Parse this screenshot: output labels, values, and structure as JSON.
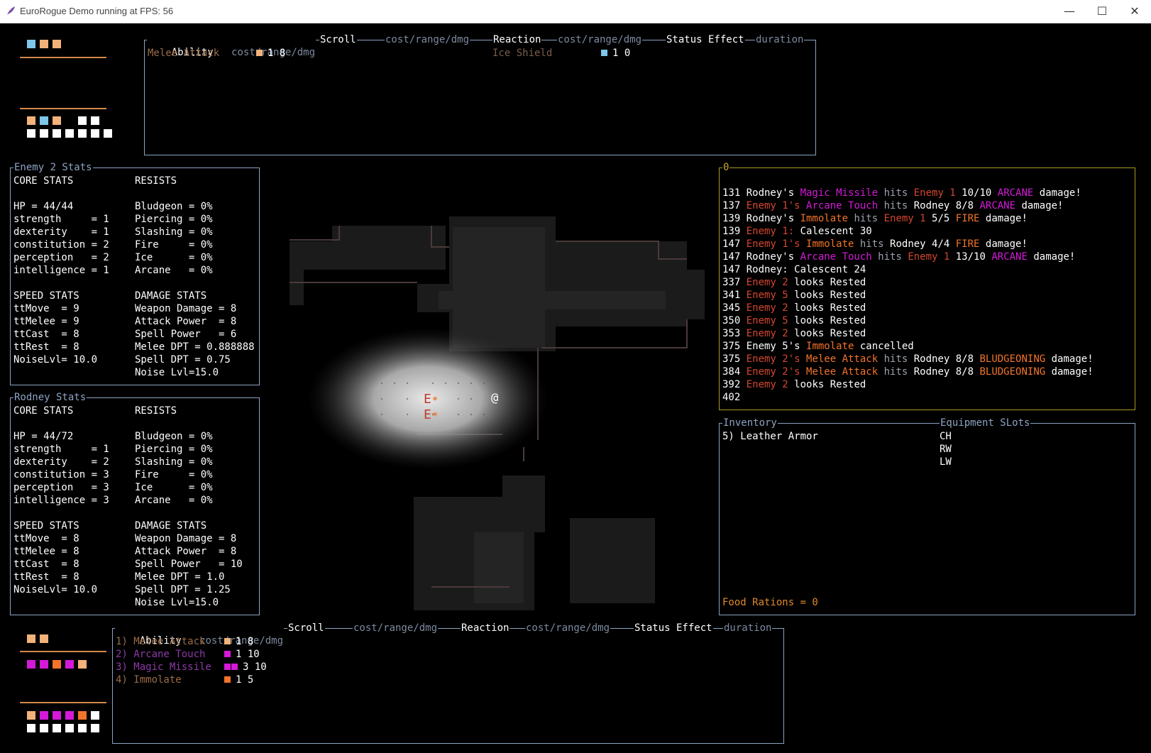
{
  "window": {
    "title": "EuroRogue Demo running at FPS: 56",
    "minimize": "—",
    "maximize": "☐",
    "close": "✕",
    "icon": "feather-icon"
  },
  "colors": {
    "panel_border": "#8da3c2",
    "log_border": "#a89a23",
    "resource_orange": "#f2b27a",
    "resource_blue": "#7ec7ea",
    "resource_magenta": "#d41ad8",
    "resource_fire": "#f2742a"
  },
  "top_ability_bar": {
    "headers": {
      "ability": "Ability",
      "ability_cost": "cost/range/dmg",
      "scroll": "Scroll",
      "scroll_cost": "cost/range/dmg",
      "reaction": "Reaction",
      "reaction_cost": "cost/range/dmg",
      "status": "Status Effect",
      "status_duration": "duration"
    },
    "abilities": [
      {
        "name": "Melee Attack",
        "cost": "1 8",
        "pip_colors": [
          "#f2b27a"
        ]
      }
    ],
    "reactions": [
      {
        "name": "Ice Shield",
        "cost": "1 0",
        "pip_colors": [
          "#7ec7ea"
        ]
      }
    ],
    "resource_row1": [
      "#7ec7ea",
      "#f2b27a",
      "#f2b27a"
    ],
    "resource_row2": [
      "#f2b27a",
      "#7ec7ea",
      "#f2b27a",
      "",
      "#ffffff",
      "#ffffff"
    ],
    "resource_row3": [
      "#ffffff",
      "#ffffff",
      "#ffffff",
      "#ffffff",
      "#ffffff",
      "#ffffff",
      "#ffffff"
    ]
  },
  "enemy_stats": {
    "title": "Enemy 2 Stats",
    "core_header": "CORE STATS",
    "resists_header": "RESISTS",
    "speed_header": "SPEED STATS",
    "damage_header": "DAMAGE STATS",
    "core": [
      "HP = 44/44",
      "strength     = 1",
      "dexterity    = 1",
      "constitution = 2",
      "perception   = 2",
      "intelligence = 1"
    ],
    "resists": [
      "Bludgeon = 0%",
      "Piercing = 0%",
      "Slashing = 0%",
      "Fire     = 0%",
      "Ice      = 0%",
      "Arcane   = 0%"
    ],
    "speed": [
      "ttMove  = 9",
      "ttMelee = 9",
      "ttCast  = 8",
      "ttRest  = 8",
      "",
      "NoiseLvl= 10.0"
    ],
    "damage": [
      "Weapon Damage = 8",
      "Attack Power  = 8",
      "Spell Power   = 6",
      "Melee DPT = 0.888888",
      "Spell DPT = 0.75",
      "Noise Lvl=15.0"
    ]
  },
  "player_stats": {
    "title": "Rodney Stats",
    "core_header": "CORE STATS",
    "resists_header": "RESISTS",
    "speed_header": "SPEED STATS",
    "damage_header": "DAMAGE STATS",
    "core": [
      "HP = 44/72",
      "strength     = 1",
      "dexterity    = 2",
      "constitution = 3",
      "perception   = 3",
      "intelligence = 3"
    ],
    "resists": [
      "Bludgeon = 0%",
      "Piercing = 0%",
      "Slashing = 0%",
      "Fire     = 0%",
      "Ice      = 0%",
      "Arcane   = 0%"
    ],
    "speed": [
      "ttMove  = 8",
      "ttMelee = 8",
      "ttCast  = 8",
      "ttRest  = 8",
      "",
      "NoiseLvl= 10.0"
    ],
    "damage": [
      "Weapon Damage = 8",
      "Attack Power  = 8",
      "Spell Power   = 10",
      "Melee DPT = 1.0",
      "Spell DPT = 1.25",
      "Noise Lvl=15.0"
    ]
  },
  "map": {
    "player_glyph": "@",
    "enemy_glyphs": [
      "E",
      "E"
    ]
  },
  "log": {
    "title": "0",
    "lines": [
      [
        [
          "131 Rodney's ",
          "white"
        ],
        [
          "Magic Missile",
          "mag"
        ],
        [
          " hits ",
          "gray"
        ],
        [
          "Enemy 1",
          "red"
        ],
        [
          " 10/10 ",
          "white"
        ],
        [
          "ARCANE",
          "mag"
        ],
        [
          " damage!",
          "white"
        ]
      ],
      [
        [
          "137 ",
          "white"
        ],
        [
          "Enemy 1's ",
          "red"
        ],
        [
          "Arcane Touch",
          "mag"
        ],
        [
          " hits ",
          "gray"
        ],
        [
          "Rodney 8/8 ",
          "white"
        ],
        [
          "ARCANE",
          "mag"
        ],
        [
          " damage!",
          "white"
        ]
      ],
      [
        [
          "139 Rodney's ",
          "white"
        ],
        [
          "Immolate",
          "orange"
        ],
        [
          " hits ",
          "gray"
        ],
        [
          "Enemy 1",
          "red"
        ],
        [
          " 5/5 ",
          "white"
        ],
        [
          "FIRE",
          "orange"
        ],
        [
          " damage!",
          "white"
        ]
      ],
      [
        [
          "139 ",
          "white"
        ],
        [
          "Enemy 1:",
          "red"
        ],
        [
          " Calescent 30",
          "white"
        ]
      ],
      [
        [
          "147 ",
          "white"
        ],
        [
          "Enemy 1's ",
          "red"
        ],
        [
          "Immolate",
          "orange"
        ],
        [
          " hits ",
          "gray"
        ],
        [
          "Rodney 4/4 ",
          "white"
        ],
        [
          "FIRE",
          "orange"
        ],
        [
          " damage!",
          "white"
        ]
      ],
      [
        [
          "147 Rodney's ",
          "white"
        ],
        [
          "Arcane Touch",
          "mag"
        ],
        [
          " hits ",
          "gray"
        ],
        [
          "Enemy 1",
          "red"
        ],
        [
          " 13/10 ",
          "white"
        ],
        [
          "ARCANE",
          "mag"
        ],
        [
          " damage!",
          "white"
        ]
      ],
      [
        [
          "147 Rodney: Calescent 24",
          "white"
        ]
      ],
      [
        [
          "337 ",
          "white"
        ],
        [
          "Enemy 2",
          "red"
        ],
        [
          " looks Rested",
          "white"
        ]
      ],
      [
        [
          "341 ",
          "white"
        ],
        [
          "Enemy 5",
          "red"
        ],
        [
          " looks Rested",
          "white"
        ]
      ],
      [
        [
          "345 ",
          "white"
        ],
        [
          "Enemy 2",
          "red"
        ],
        [
          " looks Rested",
          "white"
        ]
      ],
      [
        [
          "350 ",
          "white"
        ],
        [
          "Enemy 5",
          "red"
        ],
        [
          " looks Rested",
          "white"
        ]
      ],
      [
        [
          "353 ",
          "white"
        ],
        [
          "Enemy 2",
          "red"
        ],
        [
          " looks Rested",
          "white"
        ]
      ],
      [
        [
          "375 Enemy 5's ",
          "white"
        ],
        [
          "Immolate",
          "orange"
        ],
        [
          " cancelled",
          "white"
        ]
      ],
      [
        [
          "375 ",
          "white"
        ],
        [
          "Enemy 2's ",
          "red"
        ],
        [
          "Melee Attack",
          "orange"
        ],
        [
          " hits ",
          "gray"
        ],
        [
          "Rodney 8/8 ",
          "white"
        ],
        [
          "BLUDGEONING",
          "orange"
        ],
        [
          " damage!",
          "white"
        ]
      ],
      [
        [
          "384 ",
          "white"
        ],
        [
          "Enemy 2's ",
          "red"
        ],
        [
          "Melee Attack",
          "orange"
        ],
        [
          " hits ",
          "gray"
        ],
        [
          "Rodney 8/8 ",
          "white"
        ],
        [
          "BLUDGEONING",
          "orange"
        ],
        [
          " damage!",
          "white"
        ]
      ],
      [
        [
          "392 ",
          "white"
        ],
        [
          "Enemy 2",
          "red"
        ],
        [
          " looks Rested",
          "white"
        ]
      ],
      [
        [
          "402",
          "white"
        ]
      ]
    ]
  },
  "inventory": {
    "title": "Inventory",
    "equipment_title": "Equipment SLots",
    "items": [
      "5) Leather Armor"
    ],
    "slots": [
      "CH",
      "RW",
      "LW"
    ],
    "food": "Food Rations = 0"
  },
  "bottom_ability_bar": {
    "headers": {
      "ability": "Ability",
      "ability_cost": "cost/range/dmg",
      "scroll": "Scroll",
      "scroll_cost": "cost/range/dmg",
      "reaction": "Reaction",
      "reaction_cost": "cost/range/dmg",
      "status": "Status Effect",
      "status_duration": "duration"
    },
    "abilities": [
      {
        "name": "1) Melee Attack",
        "cost": "1 8",
        "pip_colors": [
          "#f2b27a"
        ],
        "color": "brown"
      },
      {
        "name": "2) Arcane Touch",
        "cost": "1 10",
        "pip_colors": [
          "#d41ad8"
        ],
        "color": "violet"
      },
      {
        "name": "3) Magic Missile",
        "cost": "3 10",
        "pip_colors": [
          "#d41ad8",
          "#d41ad8"
        ],
        "color": "violet"
      },
      {
        "name": "4) Immolate",
        "cost": "1 5",
        "pip_colors": [
          "#f2742a"
        ],
        "color": "brown"
      }
    ],
    "resource_row1": [
      "#f2b27a",
      "#f2b27a"
    ],
    "resource_row2": [
      "#d41ad8",
      "#d41ad8",
      "#f2742a",
      "#d41ad8",
      "#f2b27a"
    ],
    "resource_row3": [
      "#f2b27a",
      "#d41ad8",
      "#d41ad8",
      "#d41ad8",
      "#f2742a",
      "#ffffff"
    ],
    "resource_row4": [
      "#ffffff",
      "#ffffff",
      "#ffffff",
      "#ffffff",
      "#ffffff",
      "#ffffff"
    ]
  }
}
